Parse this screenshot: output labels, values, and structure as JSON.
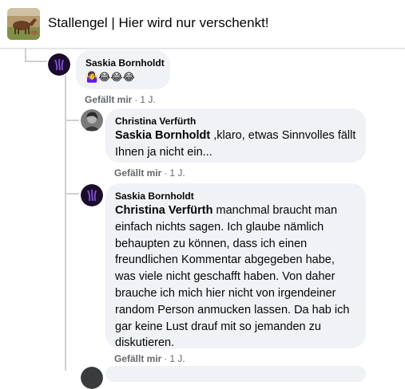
{
  "header": {
    "title": "Stallengel | Hier wird nur verschenkt!"
  },
  "comments": [
    {
      "author": "Saskia Bornholdt",
      "emoji": "🤷‍♀️😂😂😂",
      "like": "Gefällt mir",
      "sep": "·",
      "time": "1 J."
    },
    {
      "author": "Christina Verfürth",
      "mention": "Saskia Bornholdt",
      "text": " ,klaro, etwas Sinnvolles fällt Ihnen ja nicht ein...",
      "like": "Gefällt mir",
      "sep": "·",
      "time": "1 J."
    },
    {
      "author": "Saskia Bornholdt",
      "mention": "Christina Verfürth",
      "text": " manchmal braucht man einfach nichts sagen. Ich glaube nämlich behaupten zu können, dass ich einen freundlichen Kommentar abgegeben habe, was viele nicht geschafft haben. Von daher brauche ich mich hier nicht von irgendeiner random Person anmucken lassen. Da hab ich gar keine Lust drauf mit so jemanden zu diskutieren.",
      "like": "Gefällt mir",
      "sep": "·",
      "time": "1 J."
    }
  ],
  "colors": {
    "bubble": "#f0f2f5",
    "meta": "#65676b",
    "thread_line": "#ced0d4"
  }
}
